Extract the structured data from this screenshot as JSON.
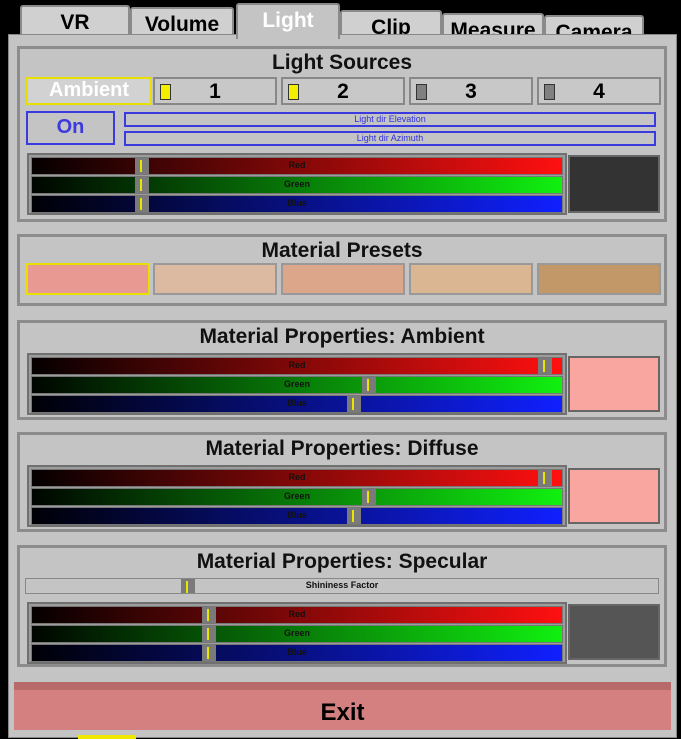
{
  "tabs": [
    {
      "label": "VR"
    },
    {
      "label": "Volume"
    },
    {
      "label": "Light"
    },
    {
      "label": "Clip"
    },
    {
      "label": "Measure"
    },
    {
      "label": "Camera"
    }
  ],
  "active_tab": "Light",
  "light_sources": {
    "title": "Light Sources",
    "ambient_label": "Ambient",
    "sources": [
      {
        "label": "1",
        "indicator_color": "#f2f000"
      },
      {
        "label": "2",
        "indicator_color": "#f2f000"
      },
      {
        "label": "3",
        "indicator_color": "#808080"
      },
      {
        "label": "4",
        "indicator_color": "#808080"
      }
    ],
    "on_label": "On",
    "elevation_label": "Light dir Elevation",
    "azimuth_label": "Light dir Azimuth",
    "color": {
      "red_label": "Red",
      "green_label": "Green",
      "blue_label": "Blue",
      "red": 0.2,
      "green": 0.2,
      "blue": 0.2
    },
    "swatch_color": "#333333"
  },
  "presets": {
    "title": "Material Presets",
    "colors": [
      "#e89a92",
      "#dcbaa2",
      "#dca68a",
      "#dbb692",
      "#c39868"
    ]
  },
  "ambient": {
    "title": "Material Properties: Ambient",
    "red_label": "Red",
    "green_label": "Green",
    "blue_label": "Blue",
    "red": 0.98,
    "green": 0.64,
    "blue": 0.61,
    "swatch_color": "#f9a5a0"
  },
  "diffuse": {
    "title": "Material Properties: Diffuse",
    "red_label": "Red",
    "green_label": "Green",
    "blue_label": "Blue",
    "red": 0.98,
    "green": 0.64,
    "blue": 0.61,
    "swatch_color": "#f9a5a0"
  },
  "specular": {
    "title": "Material Properties: Specular",
    "shininess_label": "Shininess Factor",
    "shininess": 0.25,
    "red_label": "Red",
    "green_label": "Green",
    "blue_label": "Blue",
    "red": 0.33,
    "green": 0.33,
    "blue": 0.33,
    "swatch_color": "#555555"
  },
  "exit_label": "Exit"
}
